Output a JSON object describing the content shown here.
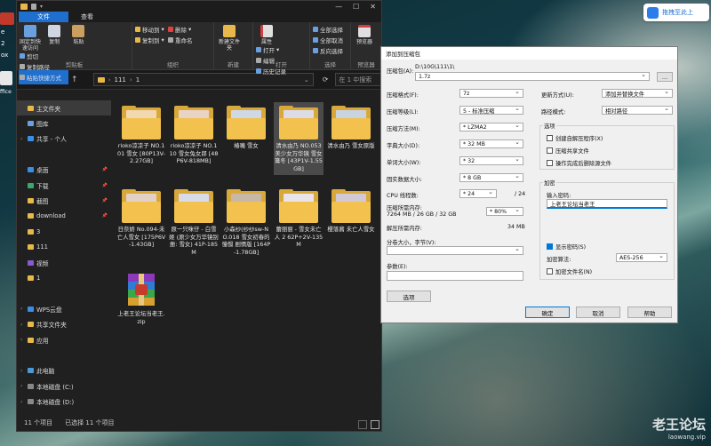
{
  "desktop": {
    "left_fragments": [
      "e",
      "2",
      "ox",
      "ffice"
    ],
    "badge_label": "拖拽至此上",
    "watermark_title": "老王论坛",
    "watermark_url": "laowang.vip"
  },
  "explorer": {
    "tabs": [
      "文件",
      "主页",
      "共享",
      "查看"
    ],
    "ribbon": {
      "clipboard": {
        "label": "剪贴板",
        "pin": "固定到快速访问",
        "copy": "复制",
        "paste": "粘贴",
        "cut": "剪切",
        "copy_path": "复制路径",
        "paste_shortcut": "粘贴快捷方式"
      },
      "organize": {
        "label": "组织",
        "move_to": "移动到",
        "copy_to": "复制到",
        "delete": "删除",
        "rename": "重命名"
      },
      "new": {
        "label": "新建",
        "new_folder": "新建文件夹"
      },
      "open": {
        "label": "打开",
        "properties": "属性",
        "open": "打开",
        "edit": "编辑",
        "history": "历史记录"
      },
      "select": {
        "label": "选择",
        "select_all": "全部选择",
        "select_none": "全部取消",
        "invert": "反向选择"
      },
      "preview": {
        "label": "预览器",
        "preview": "预览器"
      }
    },
    "address": [
      "111",
      "1"
    ],
    "search_placeholder": "在 1 中搜索",
    "sidebar": [
      {
        "label": "主文件夹",
        "icon": "home-icon",
        "selected": true
      },
      {
        "label": "图库",
        "icon": "gallery-icon"
      },
      {
        "label": "共享 - 个人",
        "icon": "cloud-icon",
        "chevron": true
      },
      {
        "label": "",
        "icon": ""
      },
      {
        "label": "桌面",
        "icon": "desktop-icon",
        "pin": true
      },
      {
        "label": "下载",
        "icon": "download-icon",
        "pin": true
      },
      {
        "label": "截图",
        "icon": "screenshot-folder-icon",
        "pin": true
      },
      {
        "label": "download",
        "icon": "folder-icon",
        "pin": true
      },
      {
        "label": "3",
        "icon": "folder-icon"
      },
      {
        "label": "111",
        "icon": "folder-icon"
      },
      {
        "label": "视频",
        "icon": "video-icon"
      },
      {
        "label": "1",
        "icon": "folder-icon"
      },
      {
        "label": "",
        "icon": ""
      },
      {
        "label": "WPS云盘",
        "icon": "wps-cloud-icon",
        "chevron": true
      },
      {
        "label": "共享文件夹",
        "icon": "folder-icon",
        "chevron": true
      },
      {
        "label": "应用",
        "icon": "folder-icon",
        "chevron": true
      },
      {
        "label": "",
        "icon": ""
      },
      {
        "label": "此电脑",
        "icon": "pc-icon",
        "chevron": true
      },
      {
        "label": "本地磁盘 (C:)",
        "icon": "drive-icon",
        "chevron": true
      },
      {
        "label": "本地磁盘 (D:)",
        "icon": "drive-icon",
        "chevron": true
      }
    ],
    "files": [
      {
        "name": "rioko凉凉子 NO.101 雪女 [80P13V-2.27GB]",
        "type": "folder",
        "paper": "#f2d8b0"
      },
      {
        "name": "rioko凉凉子 NO.110 雪女兔女郎 [48P6V-818MB]",
        "type": "folder",
        "paper": "#e9d3c5"
      },
      {
        "name": "椿嘰 雪女",
        "type": "folder",
        "paper": "#cfd8e6"
      },
      {
        "name": "清水由乃 NO.053 美少女万华镜 雪女篝冬 [43P1V-1.55GB]",
        "type": "folder",
        "paper": "#dcdce6",
        "selected": true
      },
      {
        "name": "清水由乃 雪女原版",
        "type": "folder",
        "paper": "#c9d4e2"
      },
      {
        "name": "日奈娇 No.094-未亡人雪女 [175P6V-1.43GB]",
        "type": "folder",
        "paper": "#e3d1c8"
      },
      {
        "name": "原一只咪仔 - 白雪姬 (原少女万华镜别册: 雪女) 41P-185M",
        "type": "folder",
        "paper": "#d8dbe8"
      },
      {
        "name": "小森纱(纱纱sw-NO.018 雪女初春的憧憬 剧情版 [164P-1.78GB]",
        "type": "folder",
        "paper": "#c7b8a8"
      },
      {
        "name": "蕾丽丽 - 雪女未亡人 2 62P+2V-135M",
        "type": "folder",
        "paper": "#e8e4ea"
      },
      {
        "name": "樱落酱 未亡人雪女",
        "type": "folder",
        "paper": "#d1c9d6"
      },
      {
        "name": "上老王论坛当老王.zip",
        "type": "archive"
      }
    ],
    "status": {
      "count": "11 个项目",
      "selected": "已选择 11 个项目"
    }
  },
  "dialog": {
    "title": "添加到压缩包",
    "archive_name_label": "压缩包(A):",
    "archive_path": "D:\\10G\\111\\1\\",
    "archive_name": "1.7z",
    "browse_label": "...",
    "format_label": "压缩格式(F):",
    "format_value": "7z",
    "level_label": "压缩等级(L):",
    "level_value": "5 - 标准压缩",
    "method_label": "压缩方法(M):",
    "method_value": "* LZMA2",
    "dict_label": "字典大小(D):",
    "dict_value": "* 32 MB",
    "word_label": "单词大小(W):",
    "word_value": "* 32",
    "solid_label": "固实数据大小:",
    "solid_value": "* 8 GB",
    "threads_label": "CPU 线程数:",
    "threads_value": "* 24",
    "threads_max": "/ 24",
    "mem_label": "压缩所需内存:",
    "mem_value": "7264 MB / 26 GB / 32 GB",
    "mem_pct": "* 80%",
    "decomp_label": "解压所需内存:",
    "decomp_value": "34 MB",
    "split_label": "分卷大小，字节(V):",
    "params_label": "参数(E):",
    "options_button": "选项",
    "update_label": "更新方式(U):",
    "update_value": "添加并替换文件",
    "path_label": "路径模式:",
    "path_value": "相对路径",
    "options_group": "选项",
    "opt_sfx": "创建自解压程序(X)",
    "opt_shared": "压缩共享文件",
    "opt_delete": "操作完成后删除源文件",
    "encrypt_group": "加密",
    "password_label": "输入密码:",
    "password_value": "上老王论坛当老王",
    "show_password": "显示密码(S)",
    "enc_method_label": "加密算法:",
    "enc_method_value": "AES-256",
    "encrypt_names": "加密文件名(N)",
    "ok": "确定",
    "cancel": "取消",
    "help": "帮助"
  },
  "colors": {
    "accent": "#1f6fcf",
    "folder": "#f2c14e",
    "folder_back": "#d9a83b",
    "sidebar_bg": "#202020",
    "dialog_bg": "#f0f0f0"
  }
}
